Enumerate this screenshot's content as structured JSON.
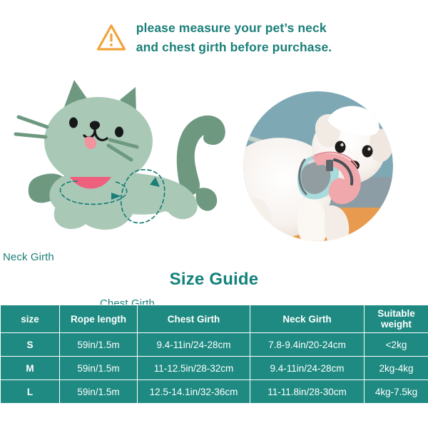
{
  "notice": {
    "icon": "warning-triangle-icon",
    "line1": "please measure your pet’s neck",
    "line2": "and chest girth before purchase."
  },
  "illustration": {
    "cat_icon": "cat-illustration",
    "neck_label": "Neck Girth",
    "chest_label": "Chest Girth",
    "photo_alt": "dog-wearing-harness-photo"
  },
  "size_guide": {
    "title": "Size Guide",
    "columns": [
      "size",
      "Rope length",
      "Chest Girth",
      "Neck Girth",
      "Suitable weight"
    ],
    "rows": [
      {
        "size": "S",
        "rope_length": "59in/1.5m",
        "chest_girth": "9.4-11in/24-28cm",
        "neck_girth": "7.8-9.4in/20-24cm",
        "suitable_weight": "<2kg"
      },
      {
        "size": "M",
        "rope_length": "59in/1.5m",
        "chest_girth": "11-12.5in/28-32cm",
        "neck_girth": "9.4-11in/24-28cm",
        "suitable_weight": "2kg-4kg"
      },
      {
        "size": "L",
        "rope_length": "59in/1.5m",
        "chest_girth": "12.5-14.1in/32-36cm",
        "neck_girth": "11-11.8in/28-30cm",
        "suitable_weight": "4kg-7.5kg"
      }
    ]
  },
  "colors": {
    "teal": "#1B7F79",
    "table_teal": "#1E8A82",
    "warning_orange": "#F2A33C",
    "cat_body": "#A9C9B6",
    "cat_dark": "#6E9980",
    "cat_pink": "#EF5F7E",
    "photo_sky": "#7FA8B5",
    "photo_floor": "#E89A4E"
  }
}
